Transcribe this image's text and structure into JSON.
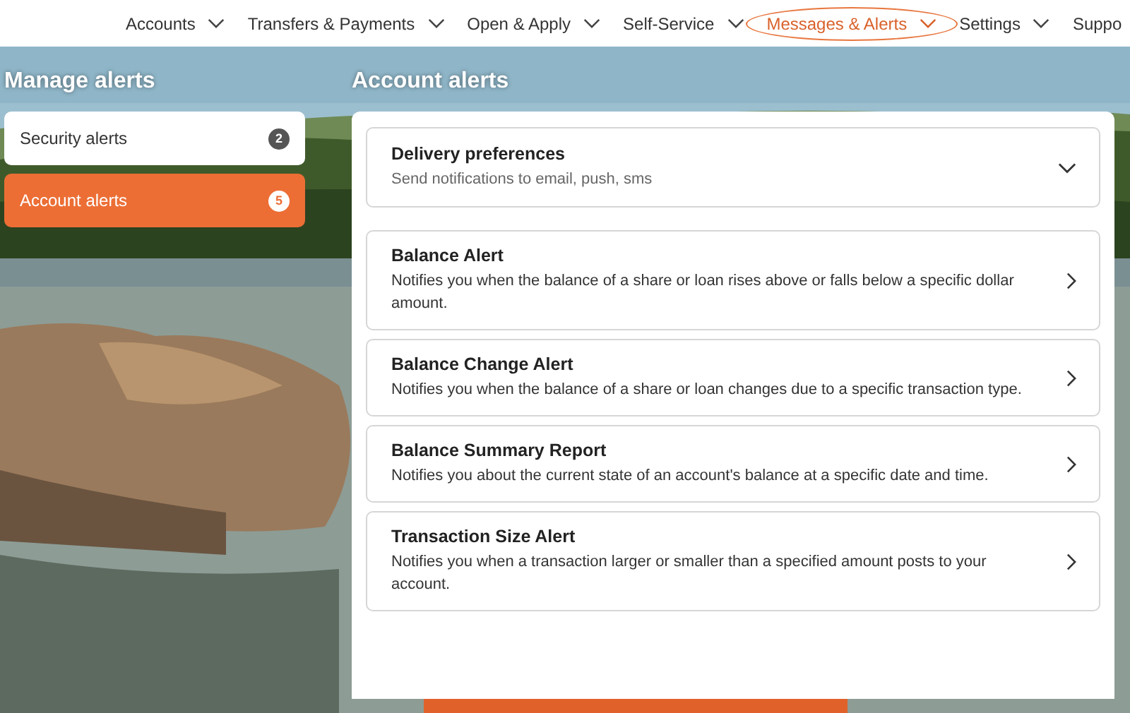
{
  "nav": [
    {
      "label": "Accounts",
      "dropdown": true,
      "selected": false
    },
    {
      "label": "Transfers & Payments",
      "dropdown": true,
      "selected": false
    },
    {
      "label": "Open & Apply",
      "dropdown": true,
      "selected": false
    },
    {
      "label": "Self-Service",
      "dropdown": true,
      "selected": false
    },
    {
      "label": "Messages & Alerts",
      "dropdown": true,
      "selected": true
    },
    {
      "label": "Settings",
      "dropdown": true,
      "selected": false
    },
    {
      "label": "Suppo",
      "dropdown": false,
      "selected": false
    }
  ],
  "sidebar": {
    "title": "Manage alerts",
    "items": [
      {
        "label": "Security alerts",
        "count": "2",
        "selected": false
      },
      {
        "label": "Account alerts",
        "count": "5",
        "selected": true
      }
    ]
  },
  "main": {
    "title": "Account alerts",
    "items": [
      {
        "kind": "accordion",
        "title": "Delivery preferences",
        "description": "Send notifications to email, push, sms"
      },
      {
        "kind": "link",
        "title": "Balance Alert",
        "description": "Notifies you when the balance of a share or loan rises above or falls below a specific dollar amount."
      },
      {
        "kind": "link",
        "title": "Balance Change Alert",
        "description": "Notifies you when the balance of a share or loan changes due to a specific transaction type."
      },
      {
        "kind": "link",
        "title": "Balance Summary Report",
        "description": "Notifies you about the current state of an account's balance at a specific date and time."
      },
      {
        "kind": "link",
        "title": "Transaction Size Alert",
        "description": "Notifies you when a transaction larger or smaller than a specified amount posts to your account."
      }
    ]
  }
}
